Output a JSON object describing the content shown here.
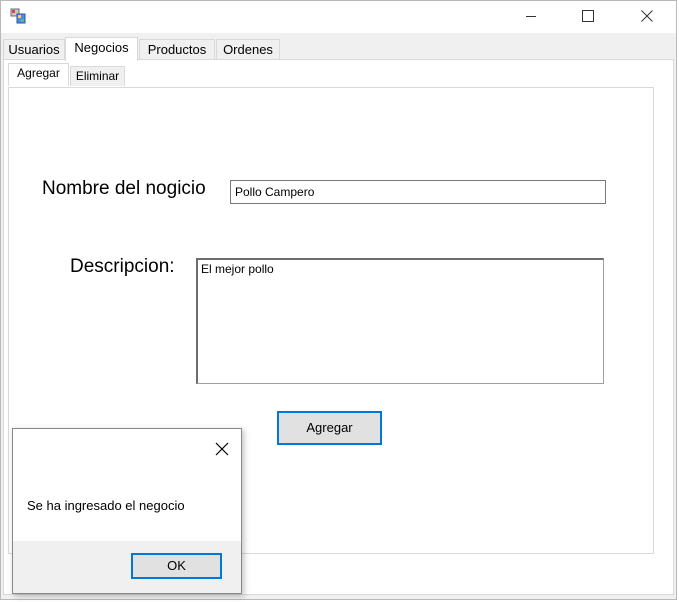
{
  "window": {
    "controls": {
      "minimize_icon": "minimize-icon",
      "maximize_icon": "maximize-icon",
      "close_icon": "close-icon"
    }
  },
  "main_tabs": [
    {
      "label": "Usuarios",
      "active": false
    },
    {
      "label": "Negocios",
      "active": true
    },
    {
      "label": "Productos",
      "active": false
    },
    {
      "label": "Ordenes",
      "active": false
    }
  ],
  "sub_tabs": [
    {
      "label": "Agregar",
      "active": true
    },
    {
      "label": "Eliminar",
      "active": false
    }
  ],
  "form": {
    "name_label": "Nombre del nogicio",
    "name_value": "Pollo Campero",
    "description_label": "Descripcion:",
    "description_value": "El mejor pollo",
    "submit_label": "Agregar"
  },
  "message_box": {
    "message": "Se ha ingresado el negocio",
    "ok_label": "OK"
  },
  "colors": {
    "accent": "#0078d7",
    "window_bg": "#f0f0f0",
    "panel_bg": "#ffffff"
  }
}
